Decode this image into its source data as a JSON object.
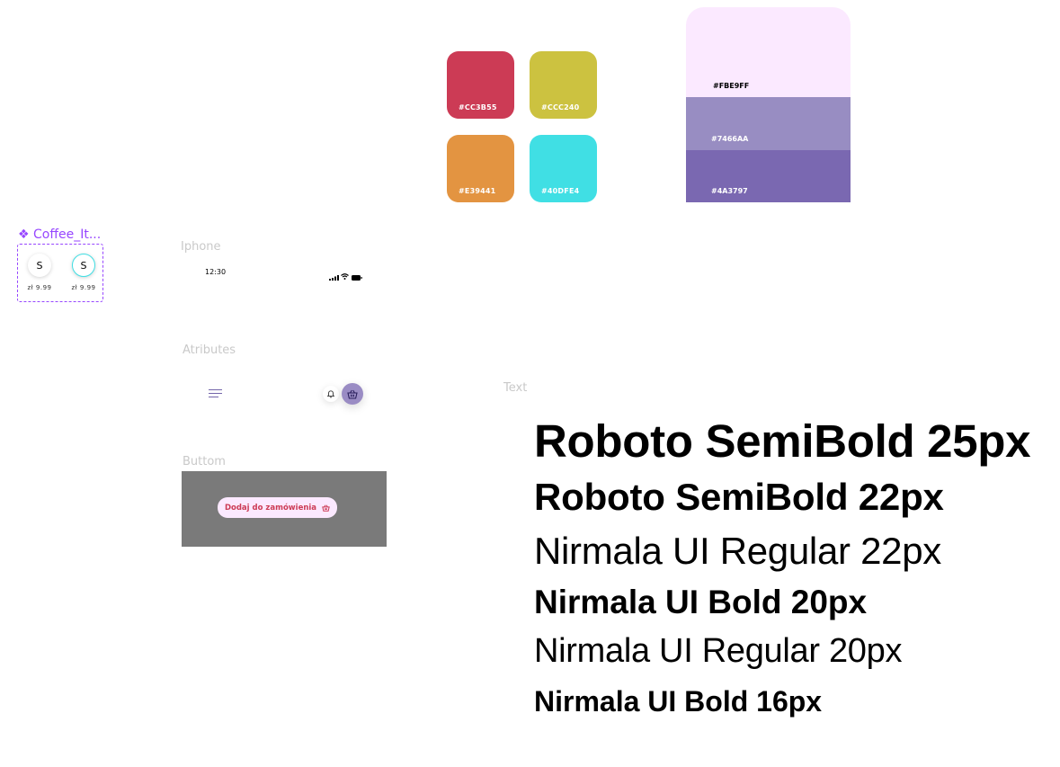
{
  "swatches": [
    {
      "hex": "#CC3B55",
      "label": "#CC3B55"
    },
    {
      "hex": "#CCC240",
      "label": "#CCC240"
    },
    {
      "hex": "#E39441",
      "label": "#E39441"
    },
    {
      "hex": "#40DFE4",
      "label": "#40DFE4"
    }
  ],
  "palette": [
    {
      "hex": "#FBE9FF",
      "label": "#FBE9FF"
    },
    {
      "hex": "#7466AA",
      "label": "#7466AA"
    },
    {
      "hex": "#4A3797",
      "label": "#4A3797"
    }
  ],
  "component": {
    "label": "❖ Coffee_It...",
    "items": [
      {
        "initial": "S",
        "price": "zł 9.99",
        "selected": false
      },
      {
        "initial": "S",
        "price": "zł 9.99",
        "selected": true
      }
    ]
  },
  "sections": {
    "iphone": "Iphone",
    "atributes": "Atributes",
    "text": "Text",
    "buttom": "Buttom"
  },
  "status_bar": {
    "time": "12:30"
  },
  "order_button": {
    "label": "Dodaj do zamówienia"
  },
  "typography": [
    "Roboto SemiBold 25px",
    "Roboto SemiBold 22px",
    "Nirmala UI Regular 22px",
    "Nirmala UI Bold 20px",
    "Nirmala UI Regular 20px",
    "Nirmala UI Bold 16px"
  ],
  "colors": {
    "accent": "#9747FF",
    "primary": "#7466AA",
    "light": "#FBE9FF"
  }
}
